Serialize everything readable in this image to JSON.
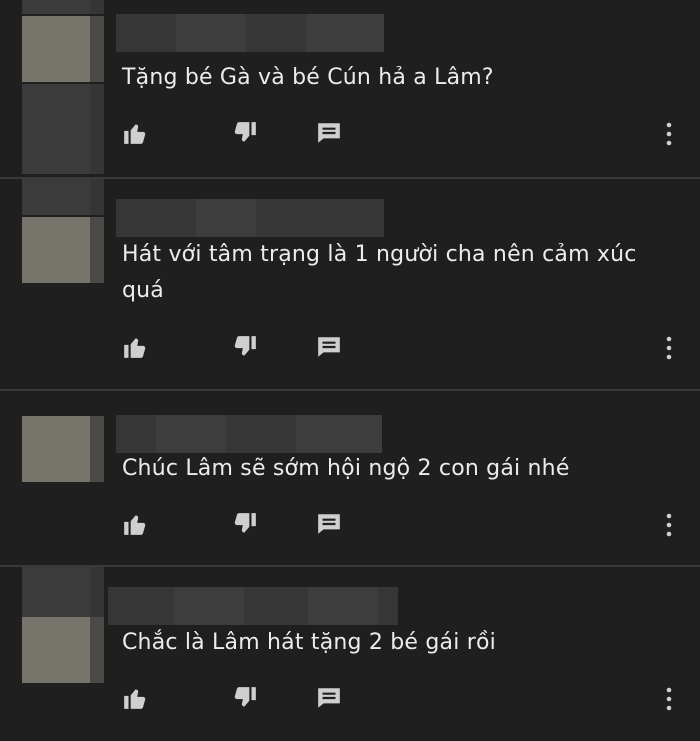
{
  "comments": [
    {
      "text": "Tặng bé Gà và bé Cún hả a Lâm?"
    },
    {
      "text": "Hát với tâm trạng là 1 người cha nên cảm xúc quá"
    },
    {
      "text": "Chúc Lâm sẽ sớm hội ngộ 2 con gái nhé"
    },
    {
      "text": "Chắc là Lâm hát tặng 2 bé gái rồi"
    }
  ],
  "icons": {
    "like": "thumb-up-icon",
    "dislike": "thumb-down-icon",
    "reply": "reply-comment-icon",
    "more": "more-vertical-icon"
  },
  "colors": {
    "background": "#1f1f1f",
    "text": "#ececec",
    "icon": "#cfcfcf",
    "divider": "#3a3a3a"
  }
}
